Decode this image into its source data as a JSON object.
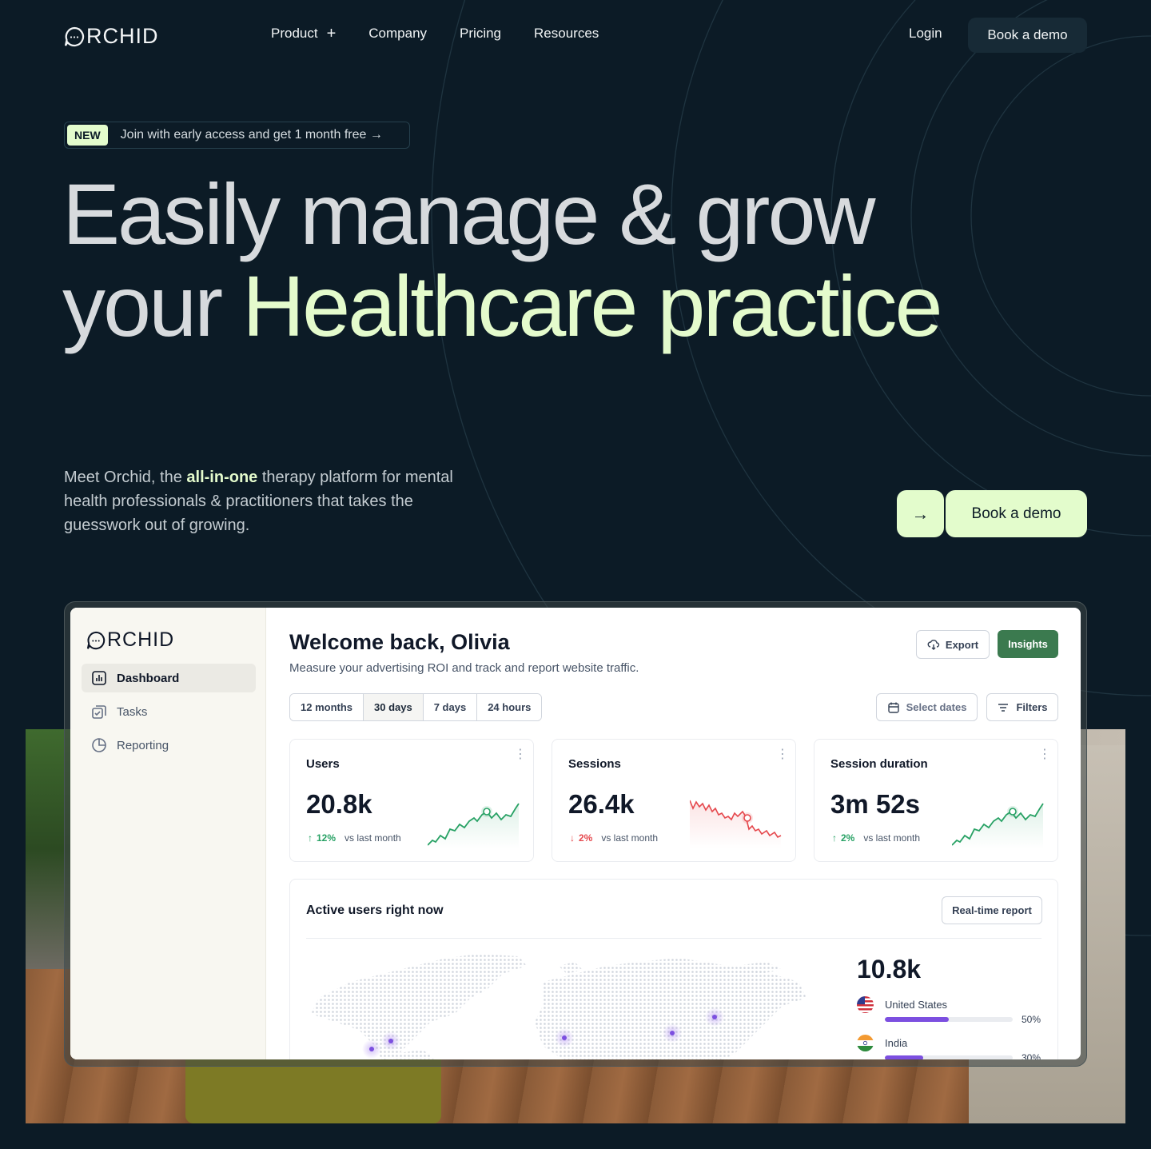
{
  "brand": {
    "name": "RCHID"
  },
  "nav": {
    "links": [
      {
        "label": "Product",
        "has_plus": true
      },
      {
        "label": "Company"
      },
      {
        "label": "Pricing"
      },
      {
        "label": "Resources"
      }
    ],
    "login": "Login",
    "demo": "Book a demo"
  },
  "announcement": {
    "badge": "NEW",
    "text": "Join with early access and get 1 month free →"
  },
  "hero": {
    "line1": "Easily manage & grow",
    "line2_plain": "your ",
    "line2_accent": "Healthcare practice",
    "sub_before": "Meet Orchid, the ",
    "sub_bold": "all-in-one",
    "sub_after": " therapy platform for mental health professionals & practitioners that takes the guesswork out of growing.",
    "cta_arrow": "→",
    "cta": "Book a demo"
  },
  "dashboard": {
    "brand": "RCHID",
    "sidebar": [
      {
        "label": "Dashboard",
        "icon": "bar-chart-icon",
        "active": true
      },
      {
        "label": "Tasks",
        "icon": "tasks-icon",
        "active": false
      },
      {
        "label": "Reporting",
        "icon": "pie-chart-icon",
        "active": false
      }
    ],
    "title": "Welcome back, Olivia",
    "subtitle": "Measure your advertising ROI and track and report website traffic.",
    "export": "Export",
    "insights": "Insights",
    "ranges": [
      "12 months",
      "30 days",
      "7 days",
      "24 hours"
    ],
    "active_range": "30 days",
    "select_dates": "Select dates",
    "filters": "Filters",
    "stats": [
      {
        "title": "Users",
        "value": "20.8k",
        "delta": "12%",
        "direction": "up",
        "vs": "vs last month",
        "color": "#27a164"
      },
      {
        "title": "Sessions",
        "value": "26.4k",
        "delta": "2%",
        "direction": "down",
        "vs": "vs last month",
        "color": "#e5484d"
      },
      {
        "title": "Session duration",
        "value": "3m 52s",
        "delta": "2%",
        "direction": "up",
        "vs": "vs last month",
        "color": "#27a164"
      }
    ],
    "active_users": {
      "title": "Active users right now",
      "button": "Real-time report",
      "total": "10.8k",
      "countries": [
        {
          "name": "United States",
          "percent": 50,
          "label": "50%"
        },
        {
          "name": "India",
          "percent": 30,
          "label": "30%"
        }
      ]
    }
  },
  "colors": {
    "background": "#0c1b26",
    "accent": "#e3fccc",
    "insights": "#3b7a4f",
    "bar": "#7c4fe0"
  }
}
